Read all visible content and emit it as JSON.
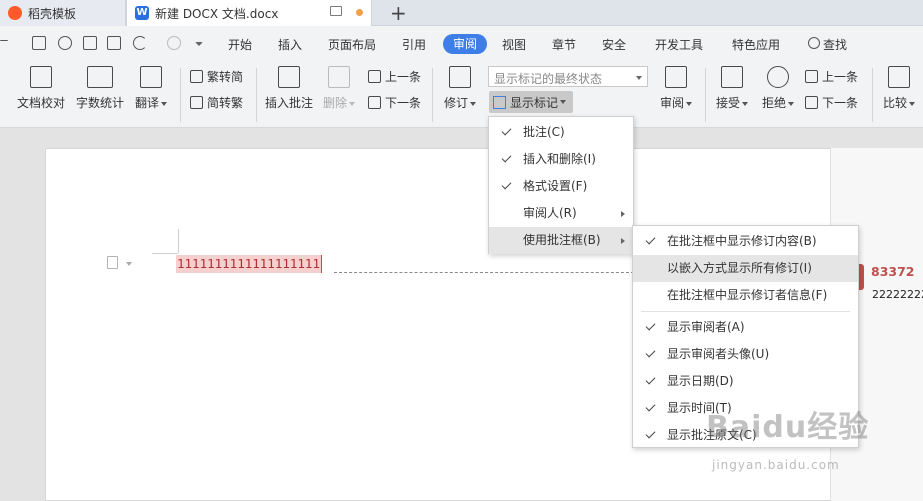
{
  "tabs": [
    {
      "label": "稻壳模板"
    },
    {
      "label": "新建 DOCX 文档.docx",
      "icon_letter": "W"
    }
  ],
  "menubar": {
    "items": [
      "开始",
      "插入",
      "页面布局",
      "引用",
      "审阅",
      "视图",
      "章节",
      "安全",
      "开发工具",
      "特色应用"
    ],
    "active": "审阅",
    "search": "查找"
  },
  "ribbon": {
    "doc_check": "文档校对",
    "word_count": "字数统计",
    "translate": "翻译",
    "trad_to_simp": "繁转简",
    "simp_to_trad": "简转繁",
    "insert_comment": "插入批注",
    "delete": "删除",
    "prev1": "上一条",
    "next1": "下一条",
    "revise": "修订",
    "display_state": "显示标记的最终状态",
    "show_marks": "显示标记",
    "review": "审阅",
    "accept": "接受",
    "reject": "拒绝",
    "prev2": "上一条",
    "next2": "下一条",
    "compare": "比较"
  },
  "menu1": {
    "items": [
      {
        "label": "批注(C)",
        "checked": true
      },
      {
        "label": "插入和删除(I)",
        "checked": true
      },
      {
        "label": "格式设置(F)",
        "checked": true
      },
      {
        "label": "审阅人(R)",
        "checked": false,
        "submenu": true
      },
      {
        "label": "使用批注框(B)",
        "checked": false,
        "submenu": true,
        "highlighted": true
      }
    ]
  },
  "menu2": {
    "group1": [
      {
        "label": "在批注框中显示修订内容(B)",
        "checked": true
      },
      {
        "label": "以嵌入方式显示所有修订(I)",
        "checked": false,
        "highlighted": true
      },
      {
        "label": "在批注框中显示修订者信息(F)",
        "checked": false
      }
    ],
    "group2": [
      {
        "label": "显示审阅者(A)",
        "checked": true
      },
      {
        "label": "显示审阅者头像(U)",
        "checked": true
      },
      {
        "label": "显示日期(D)",
        "checked": true
      },
      {
        "label": "显示时间(T)",
        "checked": true
      },
      {
        "label": "显示批注原文(C)",
        "checked": true
      }
    ]
  },
  "document": {
    "text": "1111111111111111111",
    "comment_author": "83372",
    "comment_text": "22222222"
  },
  "watermark": {
    "main": "Baidu经验",
    "sub": "jingyan.baidu.com"
  },
  "colors": {
    "accent": "#3d7fe6",
    "comment": "#c0504d",
    "inserted_bg": "#f6d0cf"
  }
}
